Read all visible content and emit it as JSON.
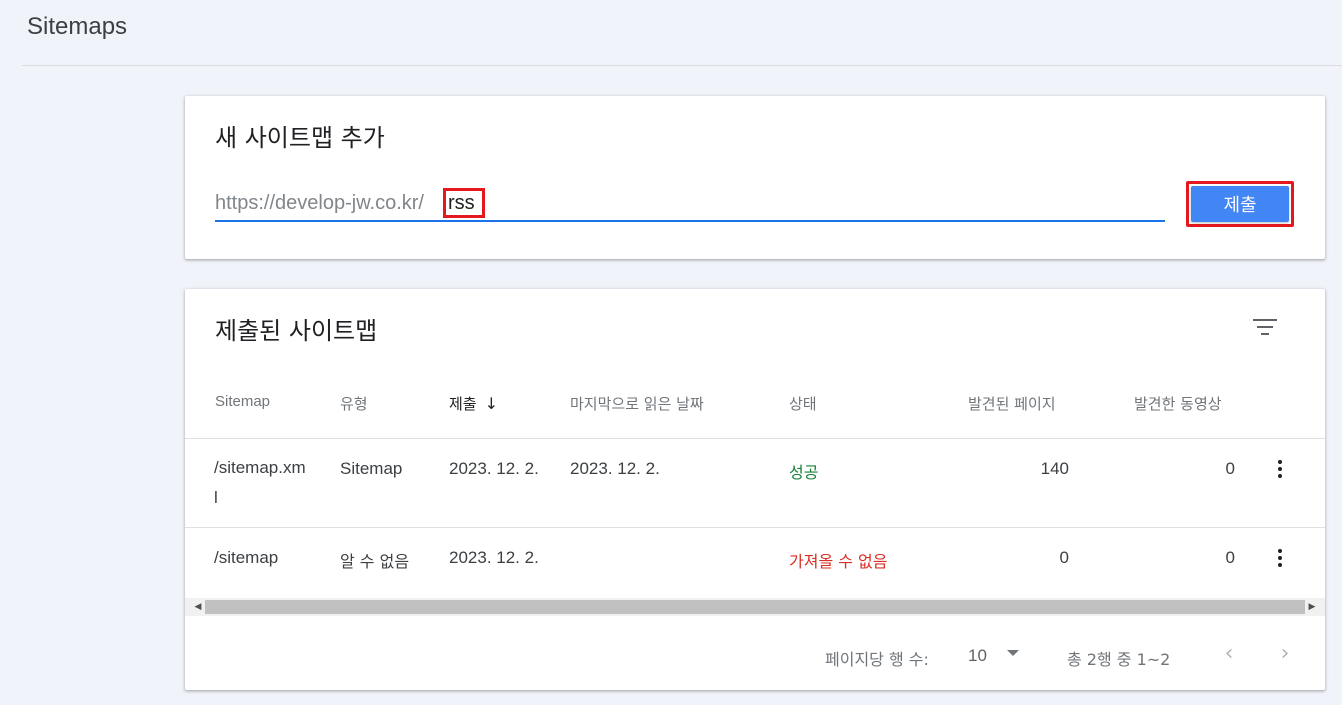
{
  "page": {
    "title": "Sitemaps"
  },
  "add_card": {
    "title": "새 사이트맵 추가",
    "url_prefix": "https://develop-jw.co.kr/",
    "input_value": "rss",
    "submit_label": "제출"
  },
  "list_card": {
    "title": "제출된 사이트맵",
    "filter_icon": "filter-list-icon",
    "columns": {
      "sitemap": "Sitemap",
      "type": "유형",
      "submitted": "제출",
      "last_read": "마지막으로 읽은 날짜",
      "status": "상태",
      "pages": "발견된 페이지",
      "videos": "발견한 동영상"
    },
    "sort_icon": "arrow-down-icon",
    "rows": [
      {
        "sitemap": "/sitemap.xml",
        "type": "Sitemap",
        "submitted": "2023. 12. 2.",
        "last_read": "2023. 12. 2.",
        "status": "성공",
        "pages": "140",
        "videos": "0"
      },
      {
        "sitemap": "/sitemap",
        "type": "알 수 없음",
        "submitted": "2023. 12. 2.",
        "last_read": "",
        "status": "가져올 수 없음",
        "pages": "0",
        "videos": "0"
      }
    ],
    "pagination": {
      "rows_per_page_label": "페이지당 행 수:",
      "rows_per_page": "10",
      "range": "총 2행 중 1~2",
      "prev": "‹",
      "next": "›"
    }
  },
  "colors": {
    "accent": "#4285f4",
    "highlight": "#e3191f",
    "success": "#188038",
    "error": "#d93025"
  }
}
